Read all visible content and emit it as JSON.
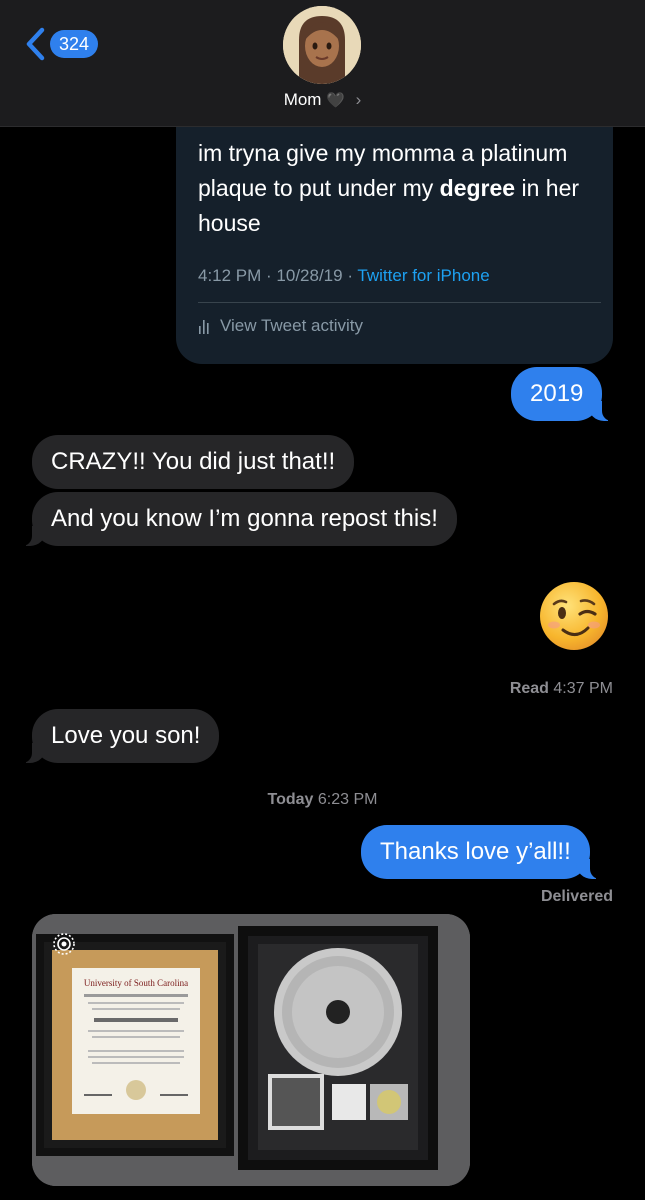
{
  "header": {
    "back_count": "324",
    "contact_name": "Mom",
    "contact_heart": "🖤",
    "chevron": "›"
  },
  "tweet": {
    "text_before": "im tryna give my momma a platinum plaque to put under my ",
    "text_bold": "degree",
    "text_after": " in her house",
    "time": "4:12 PM",
    "date": "10/28/19",
    "source": "Twitter for iPhone",
    "activity": "View Tweet activity"
  },
  "messages": {
    "m1": "2019",
    "m2": "CRAZY!! You did just that!!",
    "m3": "And you know I’m gonna repost this!",
    "m4": "Love you son!",
    "m5": "Thanks love y’all!!"
  },
  "status": {
    "read_label": "Read",
    "read_time": "4:37 PM",
    "today_label": "Today",
    "today_time": "6:23 PM",
    "delivered": "Delivered"
  },
  "photo": {
    "diploma_title": "University of South Carolina"
  },
  "colors": {
    "blue_bubble": "#2f80ed",
    "gray_bubble": "#262628",
    "tweet_bg": "#15202b",
    "twitter_blue": "#1da1f2"
  },
  "icons": {
    "back": "chevron-left-icon",
    "live_photo": "live-photo-icon",
    "activity": "bar-chart-icon",
    "emoji": "winking-face"
  }
}
